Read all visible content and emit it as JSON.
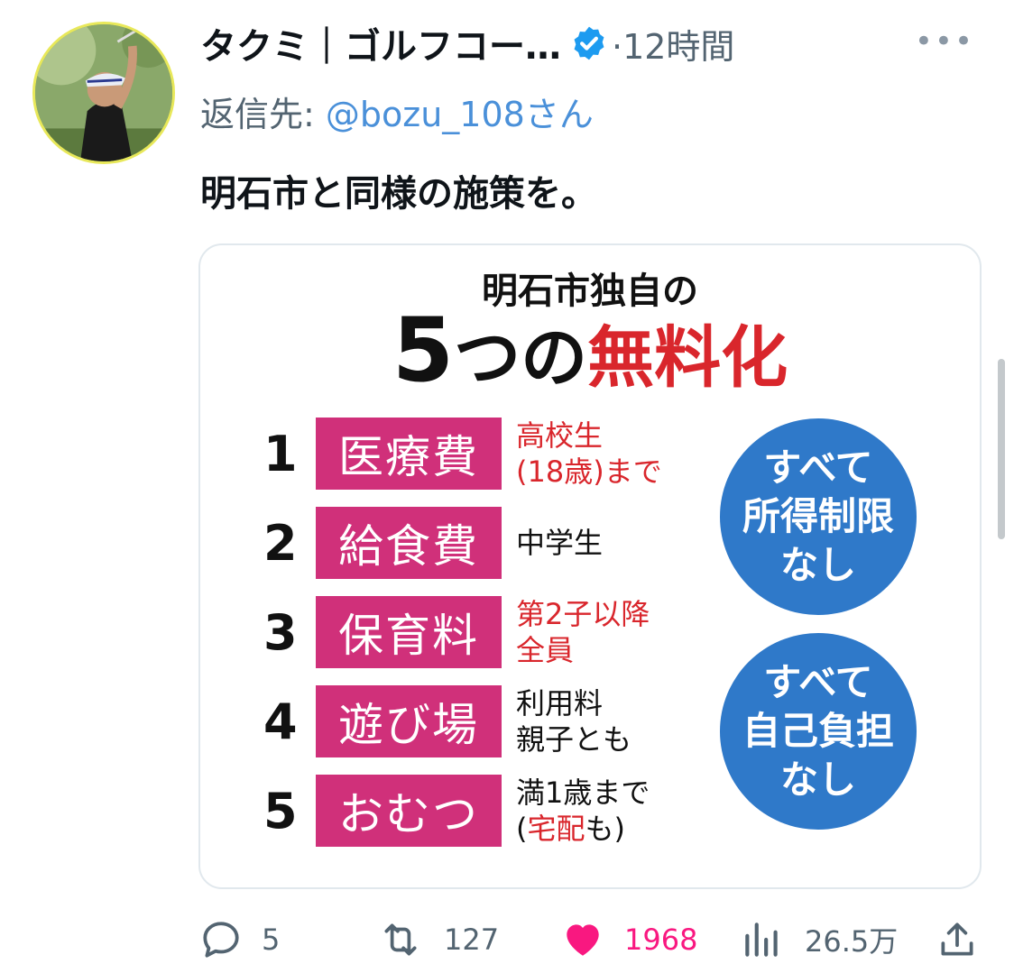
{
  "tweet": {
    "display_name": "タクミ｜ゴルフコー…",
    "time": "·12時間",
    "reply_prefix": "返信先: ",
    "reply_handle": "@bozu_108さん",
    "text": "明石市と同様の施策を。"
  },
  "image": {
    "title_line1": "明石市独自の",
    "title_num": "5",
    "title_mid": "つの",
    "title_red": "無料化",
    "items": [
      {
        "num": "1",
        "label": "医療費",
        "note_line1": "高校生",
        "note_line2": "(18歳)まで",
        "note_color": "#d9262c"
      },
      {
        "num": "2",
        "label": "給食費",
        "note_line1": "中学生",
        "note_line2": "",
        "note_color": "#111111"
      },
      {
        "num": "3",
        "label": "保育料",
        "note_line1": "第2子以降",
        "note_line2": "全員",
        "note_color": "#d9262c"
      },
      {
        "num": "4",
        "label": "遊び場",
        "note_line1": "利用料",
        "note_line2": "親子とも",
        "note_color": "#111111"
      },
      {
        "num": "5",
        "label": "おむつ",
        "note_line1": "満1歳まで",
        "note_line2_open": "(",
        "note_line2_red": "宅配",
        "note_line2_close": "も)",
        "note_color": "#111111"
      }
    ],
    "circle1": {
      "line1": "すべて",
      "line2": "所得制限",
      "line3": "なし"
    },
    "circle2": {
      "line1": "すべて",
      "line2": "自己負担",
      "line3": "なし"
    }
  },
  "actions": {
    "replies": "5",
    "retweets": "127",
    "likes": "1968",
    "views": "26.5万"
  },
  "colors": {
    "accent_pink": "#d0307a",
    "accent_red": "#d9262c",
    "circle_blue": "#2f79c9",
    "like_pink": "#f91880",
    "verified_blue": "#1d9bf0"
  },
  "icons": [
    "verified-badge-icon",
    "more-icon",
    "reply-icon",
    "retweet-icon",
    "like-icon",
    "views-icon",
    "share-icon"
  ]
}
